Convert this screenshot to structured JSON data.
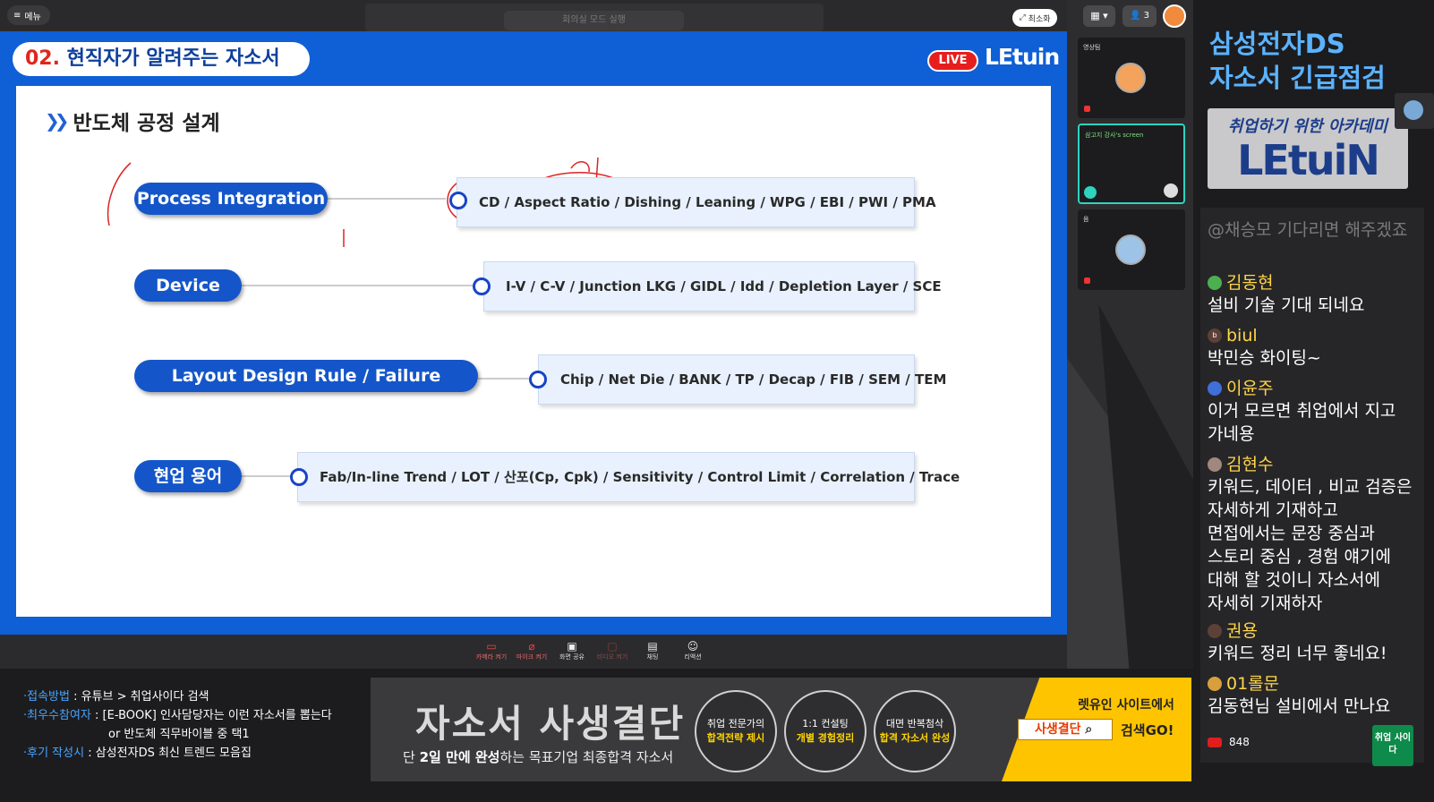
{
  "topbar": {
    "menu_label": "메뉴",
    "ghost_label": "회의실 모드 실행",
    "minimize_label": "최소화"
  },
  "slide": {
    "number": "02.",
    "title": " 현직자가 알려주는 자소서",
    "live_badge": "LIVE",
    "logo": "LEtuin",
    "section_title": "반도체 공정 설계",
    "rows": [
      {
        "label": "Process Integration",
        "detail": "CD / Aspect Ratio / Dishing / Leaning / WPG / EBI / PWI / PMA"
      },
      {
        "label": "Device",
        "detail": "I-V / C-V / Junction LKG / GIDL / Idd / Depletion Layer / SCE"
      },
      {
        "label": "Layout Design Rule / Failure Analysis",
        "detail": "Chip / Net Die / BANK / TP / Decap / FIB / SEM / TEM"
      },
      {
        "label": "현업 용어",
        "detail": "Fab/In-line Trend / LOT / 산포(Cp, Cpk) / Sensitivity / Control Limit / Correlation / Trace"
      }
    ]
  },
  "toolbar": {
    "buttons": [
      "카메라 켜기",
      "마이크 켜기",
      "화면 공유",
      "비디오 켜기",
      "채팅",
      "리액션"
    ]
  },
  "info": {
    "line1_key": "·접속방법",
    "line1_val": " : 유튜브 > 취업사이다 검색",
    "line2_key": "·최우수참여자",
    "line2_val": " : [E-BOOK] 인사담당자는 이런 자소서를 뽑는다",
    "line2b": "or 반도체 직무바이블 중 택1",
    "line3_key": "·후기 작성시",
    "line3_val": " : 삼성전자DS 최신 트렌드 모음집"
  },
  "banner": {
    "title": "자소서 사생결단",
    "sub_pre": "단 ",
    "sub_bold": "2일 만에 완성",
    "sub_post": "하는 목표기업 최종합격 자소서",
    "circles": [
      {
        "top": "취업 전문가의",
        "hl": "합격전략 제시"
      },
      {
        "top": "1:1 컨설팅",
        "hl": "개별 경험정리"
      },
      {
        "top": "대면 반복첨삭",
        "hl": "합격 자소서 완성"
      }
    ],
    "cta_label": "렛유인 사이트에서",
    "search_text": "사생결단",
    "go_text": "검색GO!"
  },
  "participants": {
    "layout_btn": "▦ ▾",
    "count": "3",
    "tiles": [
      {
        "label": "영상팀"
      },
      {
        "label": "삼고지 강사's screen"
      },
      {
        "label": "음"
      }
    ]
  },
  "chat": {
    "title_line1": "삼성전자DS",
    "title_line2": "자소서 긴급점검",
    "academy_script": "취업하기 위한 아카데미",
    "academy_logo": "LEtuiN",
    "faded_msg": "@채승모 기다리면 해주겠죠",
    "messages": [
      {
        "name": "김동현",
        "text": "설비 기술 기대 되네요"
      },
      {
        "name": "biul",
        "text": "박민승 화이팅~"
      },
      {
        "name": "이윤주",
        "text": "이거 모르면 취업에서 지고 가네용"
      },
      {
        "name": "김현수",
        "text": "키워드, 데이터 , 비교 검증은 자세하게 기재하고 면접에서는 문장 중심과 스토리 중심 , 경험 얘기에 대해 할 것이니 자소서에 자세히 기재하자"
      },
      {
        "name": "권용",
        "text": "키워드 정리 너무 좋네요!"
      },
      {
        "name": "01롤문",
        "text": "김동현님 설비에서 만나요"
      }
    ],
    "viewer_count": "848",
    "corner_logo": "취업 사이다"
  },
  "colors": {
    "slide_blue": "#0f5fd6",
    "pill_blue": "#1456c9",
    "chat_name": "#ffd54a",
    "chat_title": "#5bb3ff",
    "banner_yellow": "#ffc400"
  }
}
